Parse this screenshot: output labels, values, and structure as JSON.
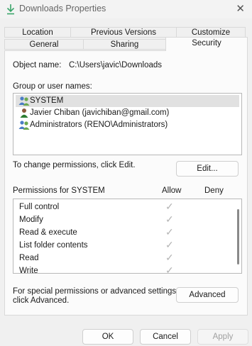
{
  "window": {
    "title": "Downloads Properties",
    "close_glyph": "✕",
    "icon": "download-arrow-icon"
  },
  "tabs_back": [
    "Location",
    "Previous Versions",
    "Customize"
  ],
  "tabs_front": [
    "General",
    "Sharing",
    "Security"
  ],
  "active_tab": "Security",
  "object_name": {
    "label": "Object name:",
    "value": "C:\\Users\\javic\\Downloads"
  },
  "groups": {
    "label": "Group or user names:",
    "items": [
      {
        "name": "SYSTEM",
        "icon": "group-users-icon",
        "selected": true
      },
      {
        "name": "Javier Chiban (javichiban@gmail.com)",
        "icon": "user-icon",
        "selected": false
      },
      {
        "name": "Administrators (RENO\\Administrators)",
        "icon": "group-users-icon",
        "selected": false
      }
    ]
  },
  "change_text": "To change permissions, click Edit.",
  "edit_button": "Edit...",
  "permissions": {
    "label": "Permissions for SYSTEM",
    "allow_header": "Allow",
    "deny_header": "Deny",
    "rows": [
      {
        "name": "Full control",
        "allow": "✓"
      },
      {
        "name": "Modify",
        "allow": "✓"
      },
      {
        "name": "Read & execute",
        "allow": "✓"
      },
      {
        "name": "List folder contents",
        "allow": "✓"
      },
      {
        "name": "Read",
        "allow": "✓"
      },
      {
        "name": "Write",
        "allow": "✓"
      }
    ]
  },
  "special": {
    "line1": "For special permissions or advanced settings,",
    "line2": "click Advanced."
  },
  "advanced_button": "Advanced",
  "footer": {
    "ok": "OK",
    "cancel": "Cancel",
    "apply": "Apply"
  }
}
